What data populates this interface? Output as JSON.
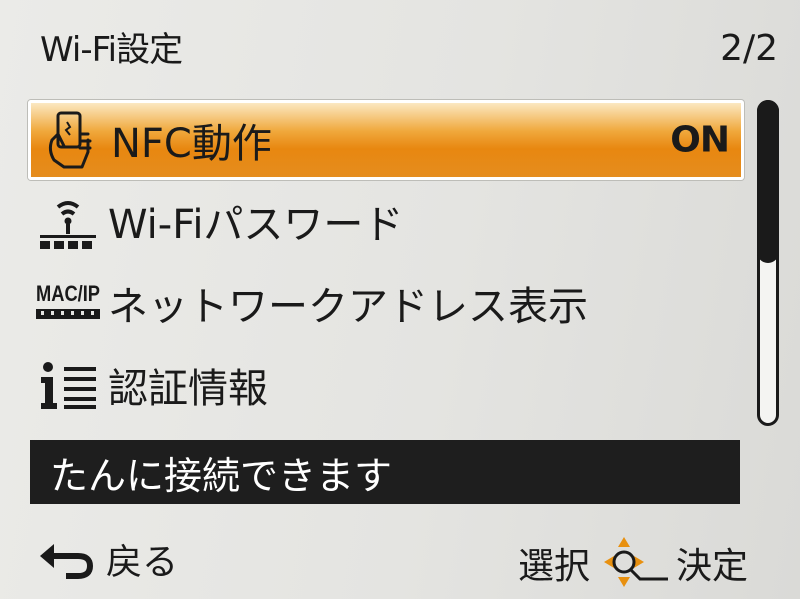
{
  "header": {
    "title": "Wi-Fi設定",
    "page": "2/2"
  },
  "menu": {
    "items": [
      {
        "icon": "nfc-hand-icon",
        "label": "NFC動作",
        "value": "ON",
        "selected": true
      },
      {
        "icon": "wifi-password-icon",
        "label": "Wi-Fiパスワード"
      },
      {
        "icon": "mac-ip-icon",
        "label": "ネットワークアドレス表示"
      },
      {
        "icon": "info-list-icon",
        "label": "認証情報"
      }
    ]
  },
  "help_text": "たんに接続できます",
  "footer": {
    "back_label": "戻る",
    "select_label": "選択",
    "confirm_label": "決定"
  },
  "scroll": {
    "position_fraction": 0.5
  },
  "colors": {
    "selected_highlight": "#e88710",
    "background": "#e6e6e3",
    "help_bar": "#1e1e1e"
  }
}
